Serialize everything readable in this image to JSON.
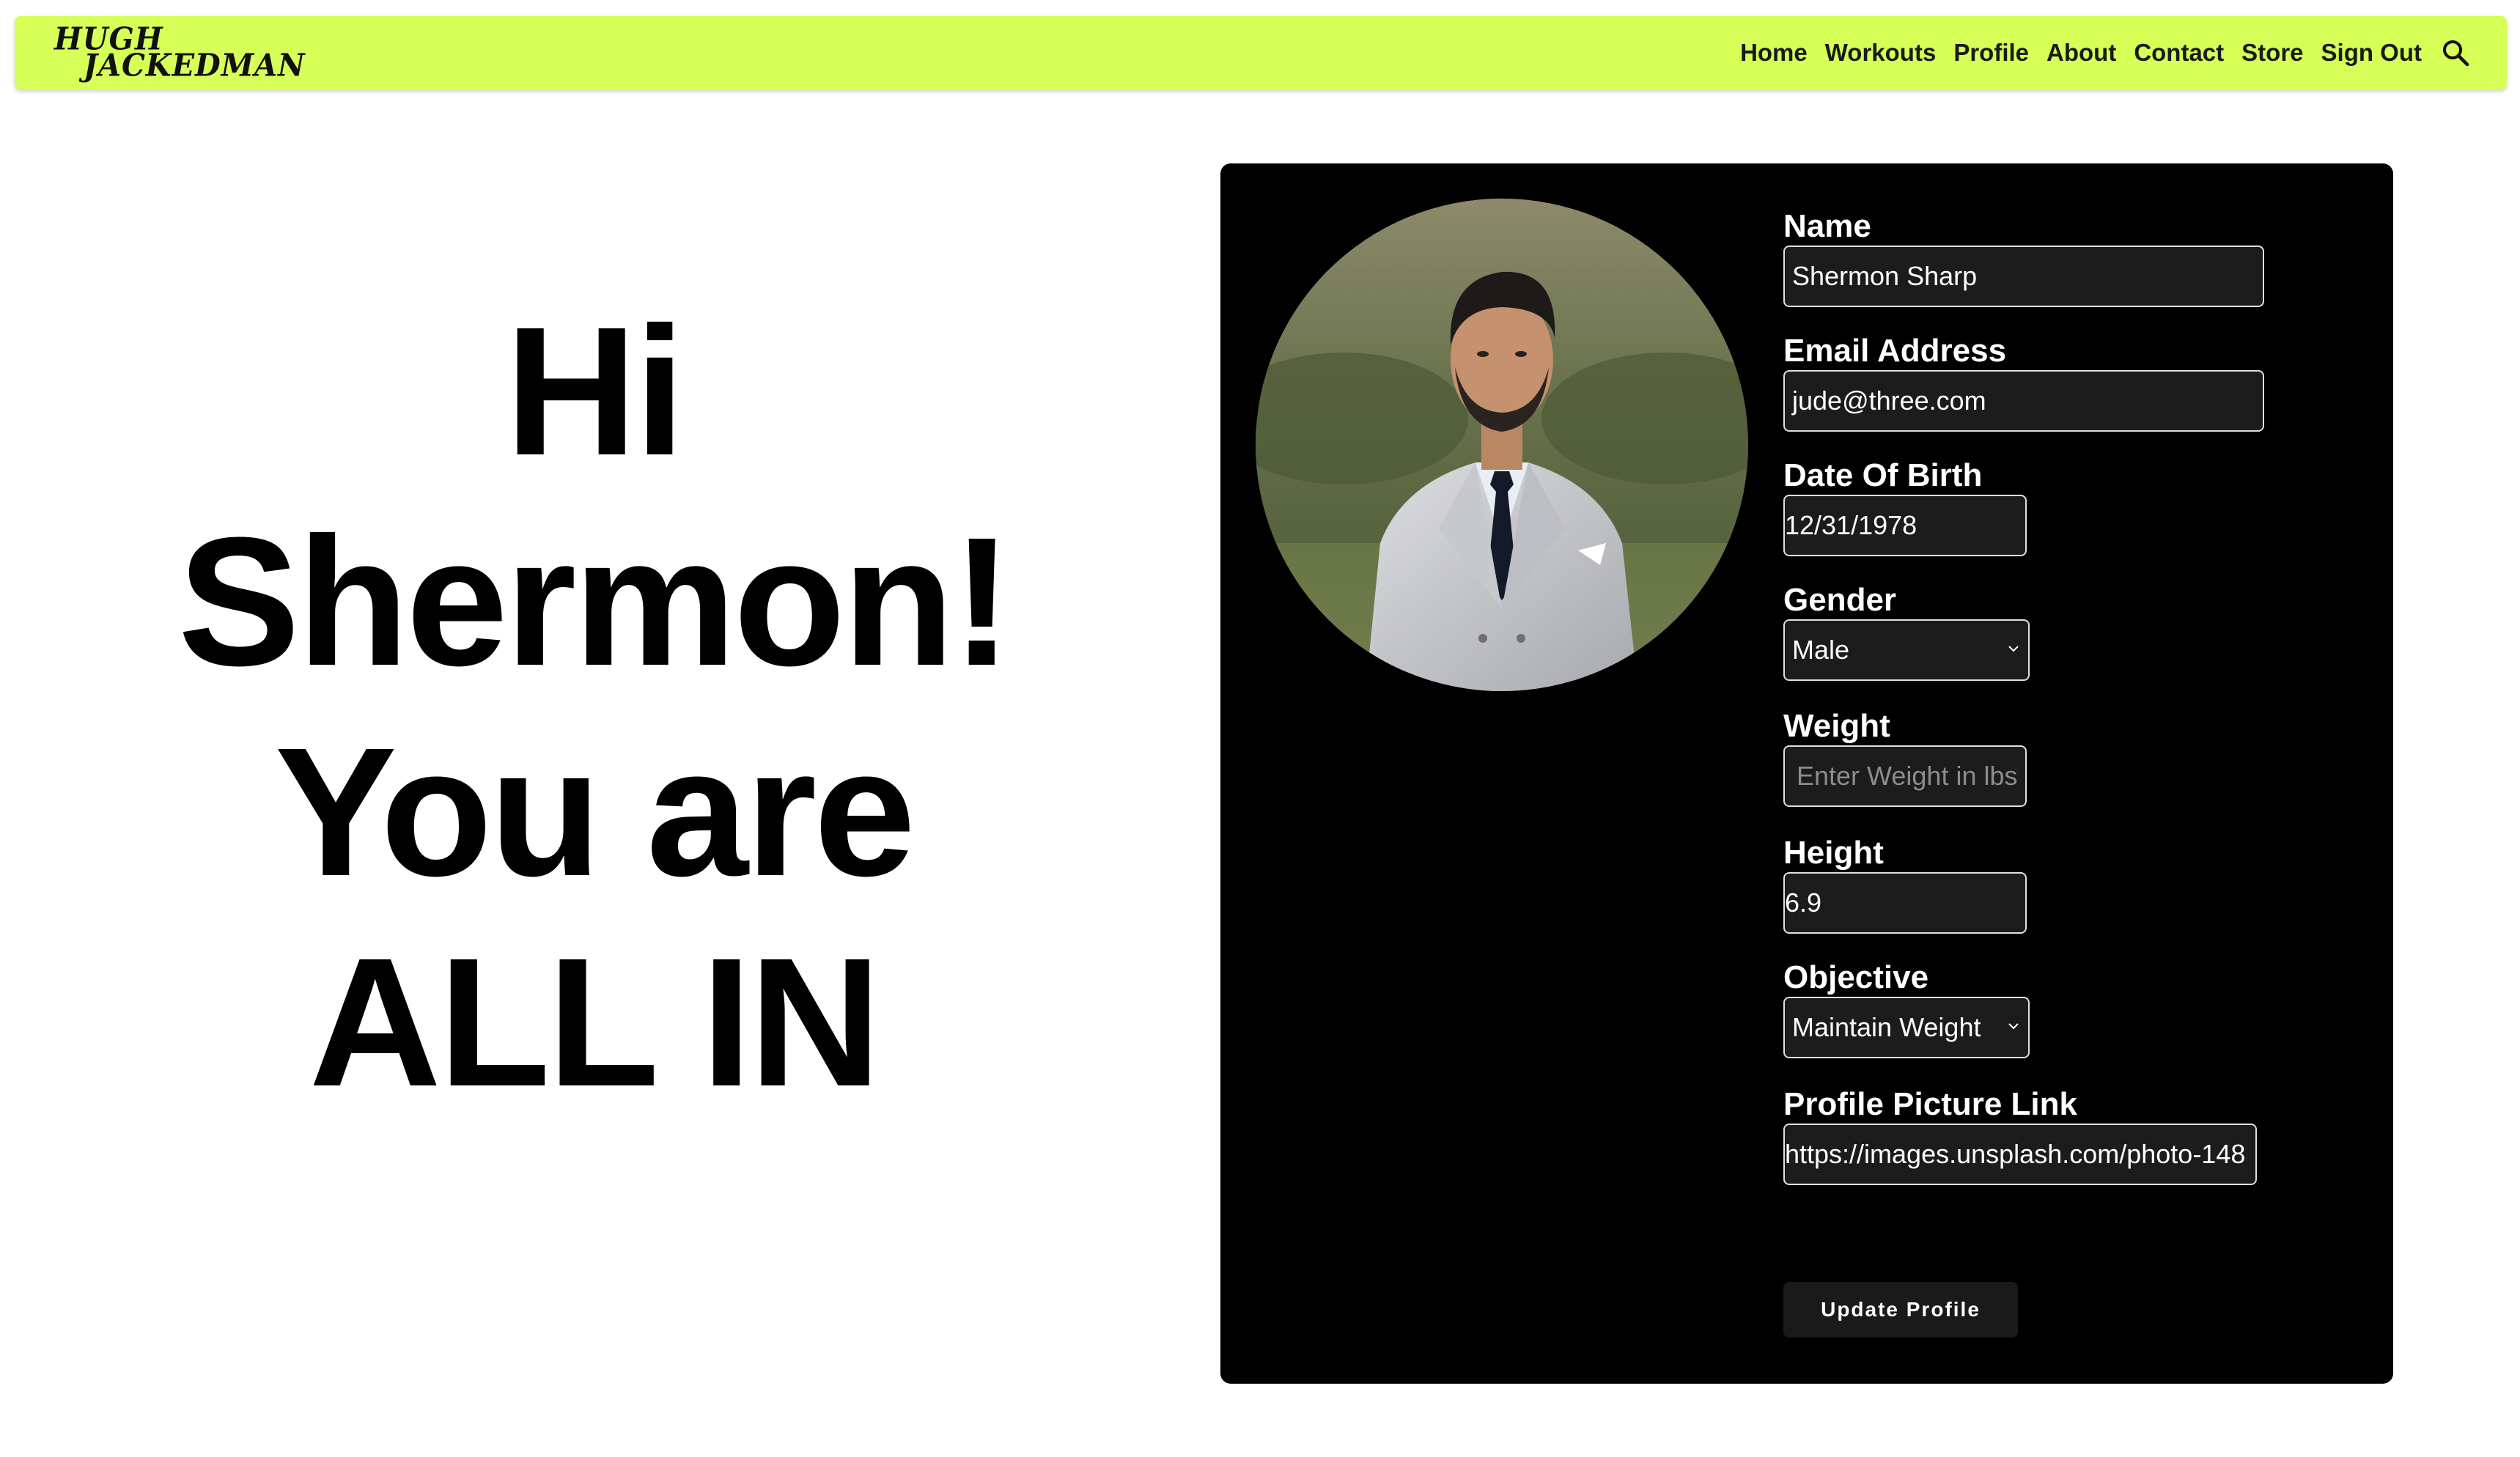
{
  "brand": {
    "logo_line1": "HUGH",
    "logo_line2": "JACKEDMAN",
    "accent_color": "#d6ff57"
  },
  "nav": {
    "items": [
      {
        "label": "Home"
      },
      {
        "label": "Workouts"
      },
      {
        "label": "Profile"
      },
      {
        "label": "About"
      },
      {
        "label": "Contact"
      },
      {
        "label": "Store"
      },
      {
        "label": "Sign Out"
      }
    ],
    "search_icon": "search-icon"
  },
  "greeting": {
    "line1": "Hi",
    "line2": "Shermon!",
    "line3": "You are",
    "line4": "ALL IN"
  },
  "profile": {
    "avatar_alt": "profile-photo",
    "fields": {
      "name": {
        "label": "Name",
        "value": "Shermon Sharp"
      },
      "email": {
        "label": "Email Address",
        "value": "jude@three.com"
      },
      "dob": {
        "label": "Date Of Birth",
        "value": "12/31/1978"
      },
      "gender": {
        "label": "Gender",
        "value": "Male"
      },
      "weight": {
        "label": "Weight",
        "value": "",
        "placeholder": "Enter Weight in lbs"
      },
      "height": {
        "label": "Height",
        "value": "6.9"
      },
      "objective": {
        "label": "Objective",
        "value": "Maintain Weight"
      },
      "picture_link": {
        "label": "Profile Picture Link",
        "value": "https://images.unsplash.com/photo-148"
      }
    },
    "update_button_label": "Update Profile"
  }
}
